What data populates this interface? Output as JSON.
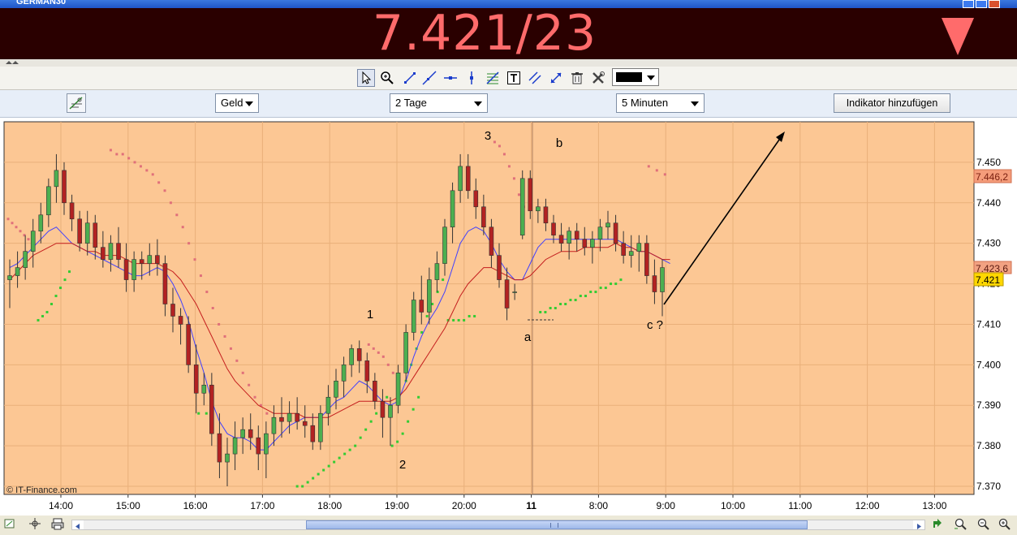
{
  "window": {
    "title": "GERMAN30"
  },
  "quote": {
    "price": "7.421/23",
    "direction_icon": "down-triangle-icon",
    "price_color": "#ff6b6b",
    "background": "#2a0000"
  },
  "toolbar": {
    "tools": [
      "pointer-icon",
      "zoom-icon",
      "trend-line-icon",
      "line-icon",
      "horizontal-line-icon",
      "vertical-line-icon",
      "fibonacci-icon",
      "text-icon",
      "parallel-lines-icon",
      "expand-icon",
      "trash-icon",
      "tools-icon"
    ],
    "color": "#000000"
  },
  "controls": {
    "price_type": "Geld",
    "period": "2 Tage",
    "interval": "5 Minuten",
    "add_indicator_label": "Indikator hinzufügen"
  },
  "chart": {
    "copyright": "© IT-Finance.com",
    "price_labels": [
      "7.446,2",
      "7.423,6",
      "7.421"
    ],
    "price_label_colors": [
      "#f59c7a",
      "#f2a282",
      "#ffd700"
    ],
    "annotations": [
      "3",
      "b",
      "1",
      "a",
      "2",
      "c ?"
    ]
  },
  "chart_data": {
    "type": "candlestick",
    "x_tick_labels": [
      "14:00",
      "15:00",
      "16:00",
      "17:00",
      "18:00",
      "19:00",
      "20:00",
      "11",
      "8:00",
      "9:00",
      "10:00",
      "11:00",
      "12:00",
      "13:00"
    ],
    "y_tick_labels": [
      "7.450",
      "7.440",
      "7.430",
      "7.420",
      "7.410",
      "7.400",
      "7.390",
      "7.380",
      "7.370"
    ],
    "ylim": [
      7368,
      7460
    ],
    "background": "#fcc794",
    "up_color": "#4caf50",
    "down_color": "#b22222",
    "ohlc": [
      [
        7421,
        7426,
        7414,
        7422
      ],
      [
        7422,
        7428,
        7419,
        7424
      ],
      [
        7424,
        7432,
        7421,
        7428
      ],
      [
        7428,
        7436,
        7424,
        7433
      ],
      [
        7433,
        7440,
        7430,
        7437
      ],
      [
        7437,
        7446,
        7434,
        7444
      ],
      [
        7444,
        7452,
        7440,
        7448
      ],
      [
        7448,
        7450,
        7437,
        7440
      ],
      [
        7440,
        7442,
        7433,
        7436
      ],
      [
        7436,
        7438,
        7428,
        7430
      ],
      [
        7430,
        7438,
        7427,
        7435
      ],
      [
        7435,
        7437,
        7426,
        7429
      ],
      [
        7429,
        7433,
        7424,
        7426
      ],
      [
        7426,
        7432,
        7423,
        7430
      ],
      [
        7430,
        7434,
        7424,
        7426
      ],
      [
        7426,
        7430,
        7418,
        7421
      ],
      [
        7421,
        7428,
        7418,
        7426
      ],
      [
        7426,
        7428,
        7421,
        7425
      ],
      [
        7425,
        7430,
        7422,
        7427
      ],
      [
        7427,
        7431,
        7422,
        7425
      ],
      [
        7425,
        7427,
        7412,
        7415
      ],
      [
        7415,
        7419,
        7408,
        7412
      ],
      [
        7412,
        7414,
        7405,
        7410
      ],
      [
        7410,
        7412,
        7398,
        7400
      ],
      [
        7400,
        7405,
        7388,
        7393
      ],
      [
        7393,
        7398,
        7390,
        7395
      ],
      [
        7395,
        7398,
        7380,
        7383
      ],
      [
        7383,
        7388,
        7372,
        7376
      ],
      [
        7376,
        7382,
        7370,
        7378
      ],
      [
        7378,
        7386,
        7374,
        7382
      ],
      [
        7382,
        7387,
        7378,
        7384
      ],
      [
        7384,
        7388,
        7379,
        7382
      ],
      [
        7382,
        7385,
        7374,
        7378
      ],
      [
        7378,
        7386,
        7372,
        7383
      ],
      [
        7383,
        7390,
        7380,
        7387
      ],
      [
        7387,
        7392,
        7382,
        7386
      ],
      [
        7386,
        7391,
        7383,
        7388
      ],
      [
        7388,
        7392,
        7384,
        7386
      ],
      [
        7386,
        7390,
        7382,
        7385
      ],
      [
        7385,
        7388,
        7379,
        7381
      ],
      [
        7381,
        7390,
        7379,
        7388
      ],
      [
        7388,
        7395,
        7385,
        7392
      ],
      [
        7392,
        7399,
        7389,
        7396
      ],
      [
        7396,
        7402,
        7392,
        7400
      ],
      [
        7400,
        7405,
        7397,
        7404
      ],
      [
        7404,
        7406,
        7398,
        7401
      ],
      [
        7401,
        7403,
        7393,
        7396
      ],
      [
        7396,
        7398,
        7389,
        7391
      ],
      [
        7391,
        7394,
        7382,
        7387
      ],
      [
        7387,
        7392,
        7380,
        7390
      ],
      [
        7390,
        7400,
        7388,
        7398
      ],
      [
        7398,
        7410,
        7396,
        7408
      ],
      [
        7408,
        7418,
        7406,
        7416
      ],
      [
        7416,
        7422,
        7410,
        7413
      ],
      [
        7413,
        7424,
        7410,
        7421
      ],
      [
        7421,
        7428,
        7418,
        7425
      ],
      [
        7425,
        7436,
        7422,
        7434
      ],
      [
        7434,
        7445,
        7430,
        7443
      ],
      [
        7443,
        7452,
        7440,
        7449
      ],
      [
        7449,
        7452,
        7441,
        7443
      ],
      [
        7443,
        7446,
        7436,
        7439
      ],
      [
        7439,
        7442,
        7432,
        7434
      ],
      [
        7434,
        7436,
        7424,
        7427
      ],
      [
        7427,
        7430,
        7419,
        7421
      ],
      [
        7421,
        7424,
        7411,
        7414
      ],
      [
        7418,
        7420,
        7416,
        7418
      ],
      [
        7432,
        7448,
        7431,
        7446
      ],
      [
        7446,
        7448,
        7436,
        7438
      ],
      [
        7438,
        7441,
        7435,
        7439
      ],
      [
        7439,
        7441,
        7433,
        7435
      ],
      [
        7435,
        7437,
        7430,
        7432
      ],
      [
        7432,
        7435,
        7428,
        7430
      ],
      [
        7430,
        7434,
        7426,
        7433
      ],
      [
        7433,
        7435,
        7428,
        7431
      ],
      [
        7431,
        7434,
        7427,
        7429
      ],
      [
        7429,
        7433,
        7425,
        7431
      ],
      [
        7431,
        7436,
        7428,
        7434
      ],
      [
        7434,
        7438,
        7431,
        7435
      ],
      [
        7435,
        7437,
        7428,
        7430
      ],
      [
        7430,
        7433,
        7425,
        7427
      ],
      [
        7427,
        7432,
        7424,
        7428
      ],
      [
        7428,
        7432,
        7423,
        7430
      ],
      [
        7430,
        7432,
        7420,
        7422
      ],
      [
        7422,
        7426,
        7415,
        7418
      ],
      [
        7418,
        7426,
        7412,
        7424
      ]
    ],
    "series": [
      {
        "name": "",
        "color": "#4040ff",
        "values": [
          7424,
          7425,
          7427,
          7429,
          7431,
          7433,
          7434,
          7432,
          7430,
          7429,
          7428,
          7427,
          7426,
          7425,
          7424,
          7423,
          7422,
          7422,
          7423,
          7424,
          7423,
          7420,
          7416,
          7411,
          7404,
          7398,
          7391,
          7386,
          7383,
          7382,
          7382,
          7381,
          7379,
          7379,
          7381,
          7383,
          7385,
          7386,
          7387,
          7387,
          7387,
          7389,
          7391,
          7392,
          7394,
          7396,
          7395,
          7393,
          7391,
          7390,
          7391,
          7396,
          7402,
          7407,
          7411,
          7414,
          7418,
          7424,
          7430,
          7433,
          7434,
          7433,
          7430,
          7426,
          7423,
          7421,
          7421,
          7425,
          7429,
          7431,
          7431,
          7431,
          7431,
          7431,
          7431,
          7431,
          7431,
          7431,
          7431,
          7430,
          7429,
          7428,
          7428,
          7427,
          7426,
          7425
        ]
      },
      {
        "name": "",
        "color": "#c41e1e",
        "values": [
          7421,
          7423,
          7425,
          7427,
          7428,
          7429,
          7430,
          7430,
          7430,
          7429,
          7428,
          7428,
          7427,
          7427,
          7427,
          7426,
          7425,
          7425,
          7425,
          7425,
          7424,
          7423,
          7421,
          7418,
          7415,
          7411,
          7407,
          7403,
          7399,
          7396,
          7394,
          7392,
          7390,
          7389,
          7388,
          7388,
          7388,
          7388,
          7387,
          7387,
          7387,
          7387,
          7388,
          7389,
          7390,
          7391,
          7391,
          7391,
          7391,
          7391,
          7392,
          7394,
          7397,
          7400,
          7403,
          7406,
          7409,
          7413,
          7417,
          7420,
          7422,
          7424,
          7424,
          7423,
          7422,
          7421,
          7421,
          7422,
          7424,
          7426,
          7427,
          7428,
          7428,
          7428,
          7429,
          7429,
          7429,
          7429,
          7430,
          7429,
          7429,
          7428,
          7428,
          7427,
          7426,
          7426
        ]
      }
    ],
    "parabolic_sar_up": [
      7411,
      7412,
      7413,
      7415,
      7417,
      7419,
      7421,
      7423,
      7388,
      7388,
      7370,
      7370,
      7371,
      7372,
      7373,
      7374,
      7375,
      7376,
      7377,
      7378,
      7379,
      7380,
      7382,
      7384,
      7386,
      7388,
      7390,
      7392,
      7380,
      7381,
      7383,
      7386,
      7389,
      7392,
      7396,
      7400,
      7404,
      7408,
      7412,
      7415,
      7418,
      7421,
      7411,
      7411,
      7411,
      7411,
      7412,
      7412,
      7413,
      7413,
      7414,
      7414,
      7415,
      7415,
      7416,
      7416,
      7417,
      7417,
      7418,
      7418,
      7419,
      7419,
      7420,
      7420,
      7421
    ],
    "parabolic_sar_down": [
      7436,
      7435,
      7434,
      7433,
      7432,
      7431,
      7430,
      7453,
      7452,
      7452,
      7451,
      7450,
      7449,
      7448,
      7447,
      7445,
      7443,
      7440,
      7437,
      7434,
      7430,
      7426,
      7422,
      7418,
      7414,
      7410,
      7407,
      7404,
      7401,
      7398,
      7395,
      7392,
      7390,
      7388,
      7405,
      7404,
      7403,
      7402,
      7400,
      7398,
      7455,
      7454,
      7452,
      7449,
      7446,
      7442,
      7439,
      7449,
      7448,
      7447
    ]
  }
}
